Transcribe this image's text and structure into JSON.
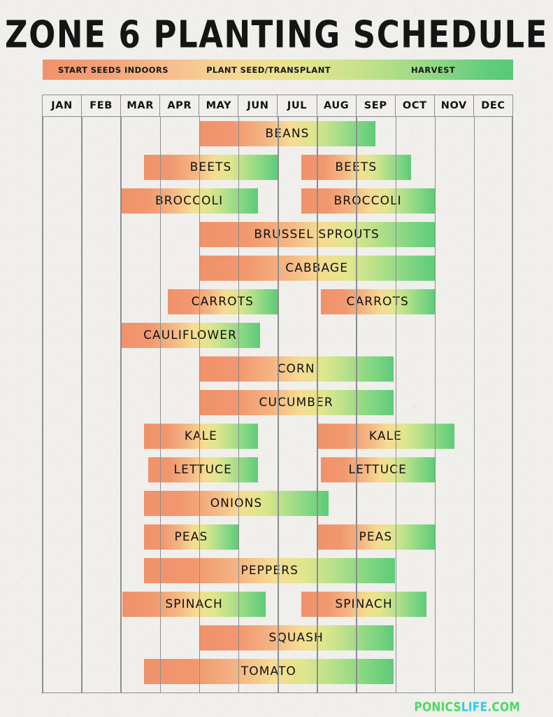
{
  "page": {
    "title": "ZONE 6 PLANTING SCHEDULE",
    "background_color": "#f0efeb"
  },
  "legend": {
    "items": [
      {
        "label": "START SEEDS INDOORS",
        "color": "#f0926b"
      },
      {
        "label": "PLANT SEED/TRANSPLANT",
        "color": "#f4dd92"
      },
      {
        "label": "HARVEST",
        "color": "#57c977"
      }
    ],
    "gradient_start": "#f0926b",
    "gradient_mid": "#f4dd92",
    "gradient_end": "#57c977"
  },
  "footer": {
    "logo_part1": "PONICS",
    "logo_part2": "LIFE",
    "logo_part3": ".COM",
    "color1": "#4cd964",
    "color2": "#2ad0e0"
  },
  "chart_data": {
    "type": "bar",
    "title": "ZONE 6 PLANTING SCHEDULE",
    "xlabel": "",
    "ylabel": "",
    "grid": true,
    "legend_position": "top",
    "categories": [
      "JAN",
      "FEB",
      "MAR",
      "APR",
      "MAY",
      "JUN",
      "JUL",
      "AUG",
      "SEP",
      "OCT",
      "NOV",
      "DEC"
    ],
    "x_axis_units": "month",
    "bar_color_stages": [
      "start-seeds-indoors",
      "plant-seed-transplant",
      "harvest"
    ],
    "rows": [
      {
        "crop": "BEANS",
        "bars": [
          {
            "label": "BEANS",
            "start_month": 5.0,
            "end_month": 9.5
          }
        ]
      },
      {
        "crop": "BEETS",
        "bars": [
          {
            "label": "BEETS",
            "start_month": 3.6,
            "end_month": 7.0
          },
          {
            "label": "BEETS",
            "start_month": 7.6,
            "end_month": 10.4
          }
        ]
      },
      {
        "crop": "BROCCOLI",
        "bars": [
          {
            "label": "BROCCOLI",
            "start_month": 3.0,
            "end_month": 6.5
          },
          {
            "label": "BROCCOLI",
            "start_month": 7.6,
            "end_month": 11.0
          }
        ]
      },
      {
        "crop": "BRUSSEL SPROUTS",
        "bars": [
          {
            "label": "BRUSSEL SPROUTS",
            "start_month": 5.0,
            "end_month": 11.0
          }
        ]
      },
      {
        "crop": "CABBAGE",
        "bars": [
          {
            "label": "CABBAGE",
            "start_month": 5.0,
            "end_month": 11.0
          }
        ]
      },
      {
        "crop": "CARROTS",
        "bars": [
          {
            "label": "CARROTS",
            "start_month": 4.2,
            "end_month": 7.0
          },
          {
            "label": "CARROTS",
            "start_month": 8.1,
            "end_month": 11.0
          }
        ]
      },
      {
        "crop": "CAULIFLOWER",
        "bars": [
          {
            "label": "CAULIFLOWER",
            "start_month": 3.0,
            "end_month": 6.55
          }
        ]
      },
      {
        "crop": "CORN",
        "bars": [
          {
            "label": "CORN",
            "start_month": 5.0,
            "end_month": 9.95
          }
        ]
      },
      {
        "crop": "CUCUMBER",
        "bars": [
          {
            "label": "CUCUMBER",
            "start_month": 5.0,
            "end_month": 9.95
          }
        ]
      },
      {
        "crop": "KALE",
        "bars": [
          {
            "label": "KALE",
            "start_month": 3.6,
            "end_month": 6.5
          },
          {
            "label": "KALE",
            "start_month": 8.0,
            "end_month": 11.5
          }
        ]
      },
      {
        "crop": "LETTUCE",
        "bars": [
          {
            "label": "LETTUCE",
            "start_month": 3.7,
            "end_month": 6.5
          },
          {
            "label": "LETTUCE",
            "start_month": 8.1,
            "end_month": 11.0
          }
        ]
      },
      {
        "crop": "ONIONS",
        "bars": [
          {
            "label": "ONIONS",
            "start_month": 3.6,
            "end_month": 8.3
          }
        ]
      },
      {
        "crop": "PEAS",
        "bars": [
          {
            "label": "PEAS",
            "start_month": 3.6,
            "end_month": 6.0
          },
          {
            "label": "PEAS",
            "start_month": 8.0,
            "end_month": 11.0
          }
        ]
      },
      {
        "crop": "PEPPERS",
        "bars": [
          {
            "label": "PEPPERS",
            "start_month": 3.6,
            "end_month": 10.0
          }
        ]
      },
      {
        "crop": "SPINACH",
        "bars": [
          {
            "label": "SPINACH",
            "start_month": 3.05,
            "end_month": 6.7
          },
          {
            "label": "SPINACH",
            "start_month": 7.6,
            "end_month": 10.8
          }
        ]
      },
      {
        "crop": "SQUASH",
        "bars": [
          {
            "label": "SQUASH",
            "start_month": 5.0,
            "end_month": 9.95
          }
        ]
      },
      {
        "crop": "TOMATO",
        "bars": [
          {
            "label": "TOMATO",
            "start_month": 3.6,
            "end_month": 9.95
          }
        ]
      }
    ]
  }
}
